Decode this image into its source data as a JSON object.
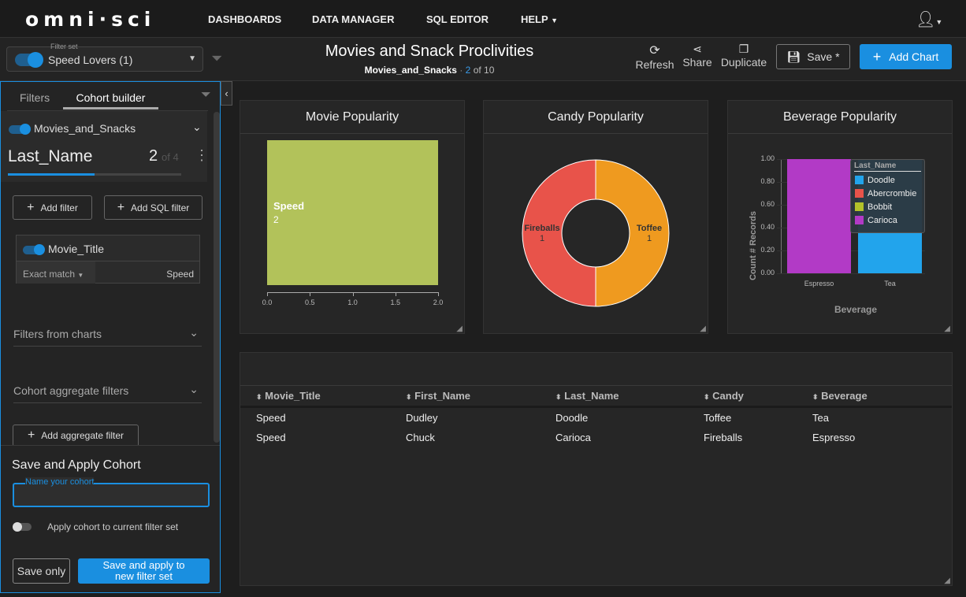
{
  "nav": {
    "logo": "omni·sci",
    "items": [
      "DASHBOARDS",
      "DATA MANAGER",
      "SQL EDITOR",
      "HELP"
    ]
  },
  "filterset": {
    "label": "Filter set",
    "value": "Speed Lovers (1)"
  },
  "dashboard": {
    "title": "Movies and Snack Proclivities",
    "source": "Movies_and_Snacks",
    "page_current": "2",
    "page_rest": "of 10"
  },
  "toolbar": {
    "refresh": "Refresh",
    "share": "Share",
    "duplicate": "Duplicate",
    "save": "Save *",
    "add_chart": "Add Chart"
  },
  "sidebar": {
    "tabs": [
      "Filters",
      "Cohort builder"
    ],
    "source": "Movies_and_Snacks",
    "dim": "Last_Name",
    "count": "2",
    "of": "of 4",
    "progress": 0.5,
    "add_filter": "Add filter",
    "add_sql_filter": "Add SQL filter",
    "filter": {
      "column": "Movie_Title",
      "mode": "Exact match",
      "value": "Speed"
    },
    "filters_from_charts": "Filters from charts",
    "cohort_agg": "Cohort aggregate filters",
    "add_agg": "Add aggregate filter",
    "save_title": "Save and Apply Cohort",
    "name_placeholder": "Name your cohort",
    "apply_label": "Apply cohort to current filter set",
    "save_only": "Save only",
    "save_apply": "Save and apply to new filter set"
  },
  "chart_data": [
    {
      "type": "bar",
      "title": "Movie Popularity",
      "orientation": "horizontal",
      "categories": [
        "Speed"
      ],
      "values": [
        2
      ],
      "xlim": [
        0,
        2
      ],
      "xticks": [
        "0.0",
        "0.5",
        "1.0",
        "1.5",
        "2.0"
      ],
      "color": "#b2c25a"
    },
    {
      "type": "pie",
      "title": "Candy Popularity",
      "donut": true,
      "labels": [
        "Fireballs",
        "Toffee"
      ],
      "values": [
        1,
        1
      ],
      "colors": [
        "#e8534a",
        "#ef9a1f"
      ]
    },
    {
      "type": "bar",
      "title": "Beverage Popularity",
      "xlabel": "Beverage",
      "ylabel": "Count # Records",
      "categories": [
        "Espresso",
        "Tea"
      ],
      "ylim": [
        0,
        1
      ],
      "yticks": [
        "0.00",
        "0.20",
        "0.40",
        "0.60",
        "0.80",
        "1.00"
      ],
      "series": [
        {
          "name": "Carioca",
          "values": [
            1,
            0
          ],
          "color": "#b23ac6"
        },
        {
          "name": "Doodle",
          "values": [
            0,
            1
          ],
          "color": "#22a4ec"
        }
      ],
      "legend": {
        "title": "Last_Name",
        "position": "top-right",
        "items": [
          {
            "name": "Doodle",
            "color": "#22a4ec"
          },
          {
            "name": "Abercrombie",
            "color": "#e8534a"
          },
          {
            "name": "Bobbit",
            "color": "#b2c22a"
          },
          {
            "name": "Carioca",
            "color": "#b23ac6"
          }
        ]
      }
    }
  ],
  "table": {
    "columns": [
      "Movie_Title",
      "First_Name",
      "Last_Name",
      "Candy",
      "Beverage"
    ],
    "rows": [
      [
        "Speed",
        "Dudley",
        "Doodle",
        "Toffee",
        "Tea"
      ],
      [
        "Speed",
        "Chuck",
        "Carioca",
        "Fireballs",
        "Espresso"
      ]
    ]
  }
}
